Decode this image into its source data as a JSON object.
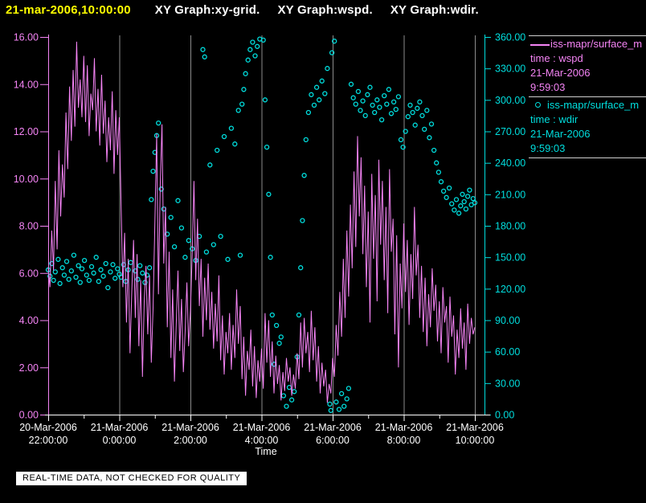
{
  "title": {
    "timestamp": "21-mar-2006,10:00:00",
    "graphs": [
      "XY Graph:xy-grid.",
      "XY Graph:wspd.",
      "XY Graph:wdir."
    ]
  },
  "legend": {
    "entries": [
      {
        "symbol": "line-symbol",
        "color": "#f584f5",
        "source": "iss-mapr/surface_m",
        "field": "time : wspd",
        "date": "21-Mar-2006",
        "time": "9:59:03"
      },
      {
        "symbol": "circle-symbol",
        "color": "#00dede",
        "source": "iss-mapr/surface_m",
        "field": "time : wdir",
        "date": "21-Mar-2006",
        "time": "9:59:03"
      }
    ]
  },
  "footer": {
    "disclaimer": "REAL-TIME DATA, NOT CHECKED FOR QUALITY"
  },
  "colors": {
    "background": "#000000",
    "wspd": "#f584f5",
    "wdir": "#00dede",
    "grid": "#8c8c8c",
    "x_axis": "#ffffff",
    "title_timestamp": "#ffff00",
    "title_text": "#ffffff",
    "footer_bg": "#ffffff",
    "footer_text": "#000000"
  },
  "chart_data": {
    "type": "line",
    "title": "",
    "xlabel": "Time",
    "grid": {
      "vertical_at_major_ticks": true,
      "color": "#8c8c8c"
    },
    "x_axis": {
      "start": "20-Mar-2006 22:00:00",
      "end": "21-Mar-2006 10:00:00",
      "hours_span": 12,
      "major_tick_every_hours": 2,
      "minor_tick_every_hours": 1,
      "tick_labels": [
        {
          "date": "20-Mar-2006",
          "time": "22:00:00"
        },
        {
          "date": "21-Mar-2006",
          "time": "0:00:00"
        },
        {
          "date": "21-Mar-2006",
          "time": "2:00:00"
        },
        {
          "date": "21-Mar-2006",
          "time": "4:00:00"
        },
        {
          "date": "21-Mar-2006",
          "time": "6:00:00"
        },
        {
          "date": "21-Mar-2006",
          "time": "8:00:00"
        },
        {
          "date": "21-Mar-2006",
          "time": "10:00:00"
        }
      ]
    },
    "left_axis": {
      "series": "wspd",
      "min": 0,
      "max": 16,
      "tick_step": 2,
      "color": "#f584f5",
      "tick_labels": [
        "16.00",
        "14.00",
        "12.00",
        "10.00",
        "8.00",
        "6.00",
        "4.00",
        "2.00",
        "0.00"
      ]
    },
    "right_axis": {
      "series": "wdir",
      "min": 0,
      "max": 360,
      "tick_step": 30,
      "color": "#00dede",
      "tick_labels": [
        "360.00",
        "330.00",
        "300.00",
        "270.00",
        "240.00",
        "210.00",
        "180.00",
        "150.00",
        "120.00",
        "90.00",
        "60.00",
        "30.00",
        "0.00"
      ]
    },
    "series": [
      {
        "name": "wspd",
        "label": "iss-mapr/surface_m time : wspd",
        "type": "line",
        "axis": "left",
        "color": "#f584f5",
        "t_start_hours": 0,
        "t_step_hours": 0.05,
        "values": [
          6.2,
          5.4,
          7.8,
          6.1,
          9.9,
          7.0,
          11.2,
          8.4,
          10.6,
          9.2,
          12.8,
          10.4,
          13.9,
          11.6,
          14.6,
          12.2,
          15.8,
          13.0,
          14.2,
          12.6,
          15.2,
          12.4,
          14.8,
          11.8,
          13.6,
          12.9,
          15.1,
          12.0,
          13.8,
          11.4,
          14.4,
          11.9,
          13.3,
          10.7,
          12.6,
          11.2,
          13.7,
          10.2,
          12.9,
          11.0,
          12.6,
          8.9,
          5.4,
          7.7,
          3.9,
          6.6,
          2.6,
          5.2,
          7.4,
          4.1,
          6.8,
          2.9,
          5.7,
          1.6,
          4.8,
          6.3,
          3.4,
          5.9,
          2.2,
          4.5,
          8.2,
          11.9,
          5.1,
          9.7,
          12.3,
          6.4,
          8.8,
          3.7,
          6.9,
          2.4,
          5.3,
          1.4,
          3.8,
          6.1,
          2.7,
          4.9,
          1.8,
          3.5,
          5.6,
          2.9,
          4.4,
          6.8,
          9.9,
          5.7,
          8.3,
          4.6,
          6.6,
          3.3,
          5.8,
          4.0,
          6.4,
          3.6,
          5.2,
          2.8,
          4.7,
          3.1,
          5.9,
          2.3,
          4.2,
          1.7,
          3.5,
          2.6,
          4.3,
          1.9,
          3.8,
          2.4,
          5.3,
          3.0,
          4.6,
          1.5,
          3.3,
          0.8,
          2.7,
          1.9,
          3.6,
          1.2,
          2.9,
          0.7,
          2.3,
          1.4,
          2.8,
          1.1,
          4.3,
          2.2,
          4.0,
          1.6,
          3.1,
          0.9,
          2.5,
          1.3,
          2.1,
          0.6,
          1.8,
          1.0,
          2.4,
          1.4,
          2.0,
          0.8,
          1.7,
          1.1,
          2.6,
          1.5,
          3.9,
          2.0,
          4.1,
          2.6,
          3.5,
          1.8,
          4.4,
          2.3,
          3.7,
          1.4,
          2.9,
          0.9,
          2.2,
          1.2,
          1.9,
          0.5,
          1.3,
          0.9,
          2.4,
          1.6,
          3.8,
          2.5,
          5.2,
          3.3,
          6.6,
          4.1,
          7.8,
          5.0,
          8.9,
          6.2,
          10.3,
          7.1,
          11.8,
          8.4,
          10.9,
          6.8,
          9.7,
          5.4,
          8.6,
          3.9,
          10.2,
          6.6,
          9.3,
          4.8,
          10.8,
          7.2,
          9.9,
          5.7,
          8.8,
          4.3,
          10.4,
          6.9,
          8.3,
          3.4,
          7.6,
          2.0,
          6.4,
          4.5,
          8.1,
          5.2,
          7.4,
          3.8,
          6.8,
          4.9,
          8.8,
          5.9,
          7.2,
          4.1,
          6.3,
          3.5,
          5.8,
          2.9,
          5.1,
          3.7,
          6.2,
          4.4,
          5.5,
          3.1,
          4.8,
          2.6,
          5.4,
          3.9,
          4.6,
          2.2,
          5.0,
          3.3,
          4.2,
          1.7,
          3.6,
          2.4,
          4.5,
          2.8,
          3.9,
          1.9,
          4.7,
          3.0,
          4.1,
          3.4,
          3.7
        ]
      },
      {
        "name": "wdir",
        "label": "iss-mapr/surface_m time : wdir",
        "type": "scatter",
        "axis": "right",
        "color": "#00dede",
        "points": [
          [
            0.0,
            138
          ],
          [
            0.05,
            132
          ],
          [
            0.1,
            144
          ],
          [
            0.15,
            128
          ],
          [
            0.2,
            136
          ],
          [
            0.28,
            148
          ],
          [
            0.33,
            125
          ],
          [
            0.4,
            140
          ],
          [
            0.45,
            133
          ],
          [
            0.52,
            146
          ],
          [
            0.58,
            129
          ],
          [
            0.65,
            137
          ],
          [
            0.72,
            152
          ],
          [
            0.78,
            131
          ],
          [
            0.85,
            142
          ],
          [
            0.9,
            126
          ],
          [
            0.95,
            139
          ],
          [
            1.02,
            147
          ],
          [
            1.08,
            133
          ],
          [
            1.15,
            128
          ],
          [
            1.22,
            141
          ],
          [
            1.28,
            135
          ],
          [
            1.35,
            150
          ],
          [
            1.42,
            127
          ],
          [
            1.48,
            138
          ],
          [
            1.55,
            132
          ],
          [
            1.62,
            144
          ],
          [
            1.68,
            121
          ],
          [
            1.75,
            136
          ],
          [
            1.82,
            143
          ],
          [
            1.88,
            130
          ],
          [
            1.95,
            139
          ],
          [
            2.0,
            134
          ],
          [
            2.05,
            131
          ],
          [
            2.12,
            143
          ],
          [
            2.18,
            127
          ],
          [
            2.25,
            138
          ],
          [
            2.32,
            145
          ],
          [
            2.45,
            137
          ],
          [
            2.52,
            129
          ],
          [
            2.58,
            142
          ],
          [
            2.65,
            135
          ],
          [
            2.72,
            126
          ],
          [
            2.78,
            133
          ],
          [
            2.85,
            140
          ],
          [
            2.9,
            205
          ],
          [
            2.95,
            232
          ],
          [
            3.0,
            250
          ],
          [
            3.05,
            266
          ],
          [
            3.1,
            278
          ],
          [
            3.18,
            215
          ],
          [
            3.25,
            196
          ],
          [
            3.35,
            172
          ],
          [
            3.45,
            188
          ],
          [
            3.55,
            160
          ],
          [
            3.65,
            204
          ],
          [
            3.75,
            178
          ],
          [
            3.85,
            150
          ],
          [
            3.95,
            166
          ],
          [
            4.05,
            158
          ],
          [
            4.15,
            147
          ],
          [
            4.25,
            170
          ],
          [
            4.35,
            348
          ],
          [
            4.4,
            341
          ],
          [
            4.45,
            155
          ],
          [
            4.55,
            238
          ],
          [
            4.65,
            162
          ],
          [
            4.75,
            252
          ],
          [
            4.85,
            170
          ],
          [
            4.95,
            265
          ],
          [
            5.05,
            148
          ],
          [
            5.15,
            273
          ],
          [
            5.25,
            258
          ],
          [
            5.35,
            290
          ],
          [
            5.4,
            152
          ],
          [
            5.45,
            296
          ],
          [
            5.5,
            310
          ],
          [
            5.55,
            325
          ],
          [
            5.62,
            338
          ],
          [
            5.68,
            348
          ],
          [
            5.75,
            355
          ],
          [
            5.82,
            342
          ],
          [
            5.88,
            351
          ],
          [
            5.95,
            358
          ],
          [
            6.05,
            357
          ],
          [
            6.1,
            300
          ],
          [
            6.15,
            255
          ],
          [
            6.2,
            210
          ],
          [
            6.25,
            150
          ],
          [
            6.3,
            95
          ],
          [
            6.35,
            48
          ],
          [
            6.42,
            85
          ],
          [
            6.5,
            68
          ],
          [
            6.55,
            74
          ],
          [
            6.62,
            18
          ],
          [
            6.7,
            8
          ],
          [
            6.78,
            26
          ],
          [
            6.85,
            14
          ],
          [
            6.92,
            22
          ],
          [
            7.0,
            55
          ],
          [
            7.05,
            95
          ],
          [
            7.1,
            140
          ],
          [
            7.15,
            185
          ],
          [
            7.2,
            228
          ],
          [
            7.25,
            262
          ],
          [
            7.32,
            288
          ],
          [
            7.4,
            305
          ],
          [
            7.48,
            295
          ],
          [
            7.55,
            312
          ],
          [
            7.62,
            300
          ],
          [
            7.7,
            318
          ],
          [
            7.78,
            306
          ],
          [
            7.85,
            330
          ],
          [
            7.92,
            10
          ],
          [
            7.95,
            4
          ],
          [
            7.98,
            345
          ],
          [
            8.05,
            356
          ],
          [
            8.1,
            12
          ],
          [
            8.18,
            5
          ],
          [
            8.25,
            20
          ],
          [
            8.32,
            8
          ],
          [
            8.4,
            15
          ],
          [
            8.45,
            25
          ],
          [
            8.52,
            315
          ],
          [
            8.58,
            302
          ],
          [
            8.65,
            296
          ],
          [
            8.72,
            308
          ],
          [
            8.78,
            290
          ],
          [
            8.85,
            299
          ],
          [
            8.92,
            285
          ],
          [
            8.98,
            305
          ],
          [
            9.05,
            312
          ],
          [
            9.12,
            295
          ],
          [
            9.18,
            288
          ],
          [
            9.25,
            300
          ],
          [
            9.32,
            293
          ],
          [
            9.38,
            281
          ],
          [
            9.45,
            304
          ],
          [
            9.52,
            296
          ],
          [
            9.58,
            310
          ],
          [
            9.65,
            287
          ],
          [
            9.72,
            298
          ],
          [
            9.78,
            291
          ],
          [
            9.85,
            303
          ],
          [
            9.92,
            262
          ],
          [
            9.98,
            255
          ],
          [
            10.05,
            270
          ],
          [
            10.12,
            284
          ],
          [
            10.18,
            295
          ],
          [
            10.25,
            288
          ],
          [
            10.32,
            276
          ],
          [
            10.38,
            292
          ],
          [
            10.45,
            298
          ],
          [
            10.52,
            285
          ],
          [
            10.58,
            272
          ],
          [
            10.65,
            290
          ],
          [
            10.72,
            264
          ],
          [
            10.78,
            277
          ],
          [
            10.85,
            252
          ],
          [
            10.92,
            240
          ],
          [
            10.98,
            231
          ],
          [
            11.05,
            222
          ],
          [
            11.12,
            213
          ],
          [
            11.2,
            207
          ],
          [
            11.28,
            216
          ],
          [
            11.35,
            201
          ],
          [
            11.42,
            195
          ],
          [
            11.48,
            205
          ],
          [
            11.55,
            192
          ],
          [
            11.6,
            199
          ],
          [
            11.65,
            210
          ],
          [
            11.7,
            203
          ],
          [
            11.75,
            196
          ],
          [
            11.8,
            208
          ],
          [
            11.85,
            214
          ],
          [
            11.9,
            200
          ],
          [
            11.95,
            206
          ],
          [
            12.0,
            202
          ]
        ]
      }
    ]
  }
}
